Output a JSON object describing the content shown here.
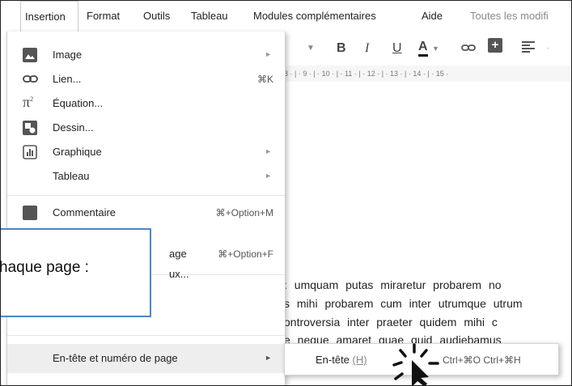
{
  "menubar": {
    "items": [
      "Insertion",
      "Format",
      "Outils",
      "Tableau",
      "Modules complémentaires",
      "Aide"
    ],
    "status": "Toutes les modifi"
  },
  "toolbar": {
    "bold": "B",
    "italic": "I",
    "underline": "U",
    "text_color": "A",
    "add_comment": "+"
  },
  "ruler": "8 · | · 9 · | · 10 · | · 11 · | · 12 · | · 13 · | · 14 · | · 15 ·",
  "menu": {
    "items": [
      {
        "label": "Image",
        "icon": "image-icon",
        "submenu": true
      },
      {
        "label": "Lien...",
        "icon": "link-icon",
        "shortcut": "⌘K"
      },
      {
        "label": "Équation...",
        "icon": "pi-icon"
      },
      {
        "label": "Dessin...",
        "icon": "drawing-icon"
      },
      {
        "label": "Graphique",
        "icon": "chart-icon",
        "submenu": true
      },
      {
        "label": "Tableau",
        "submenu": true
      },
      {
        "label": "Commentaire",
        "icon": "comment-icon",
        "shortcut": "⌘+Option+M"
      },
      {
        "label": "age",
        "shortcut": "⌘+Option+F"
      },
      {
        "label": "ux..."
      },
      {
        "label": "En-tête et numéro de page",
        "submenu": true,
        "highlighted": true
      }
    ]
  },
  "submenu": {
    "label": "En-tête",
    "accelerator": "(H)",
    "shortcut": "Ctrl+⌘O Ctrl+⌘H"
  },
  "callout": {
    "text": "haque page :"
  },
  "document": {
    "lines": [
      ": umquam putas miraretur probarem no",
      "s mihi probarem cum inter utrumque utrum",
      "ontroversia inter praeter quidem mihi c",
      "e neque amaret quae quid audiebamus"
    ]
  },
  "colors": {
    "callout_border": "#4a86c8",
    "highlight": "#eeeeee"
  }
}
